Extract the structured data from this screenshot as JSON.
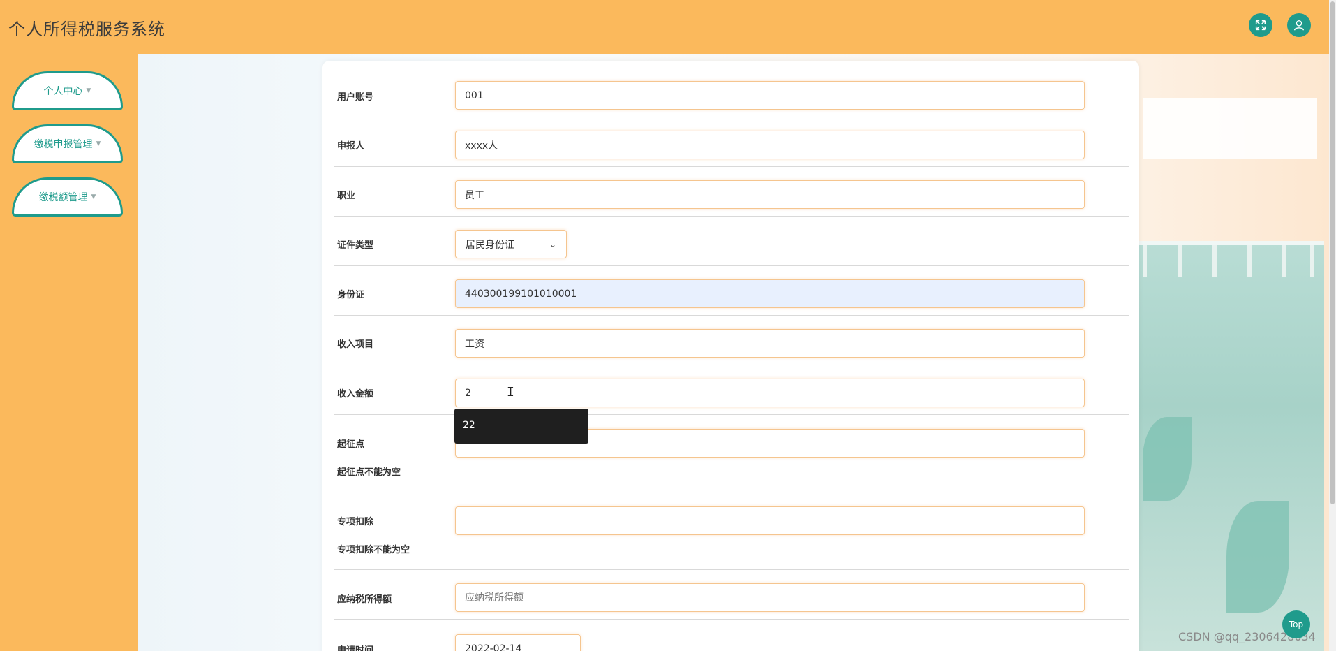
{
  "app_title": "个人所得税服务系统",
  "header_icons": {
    "fullscreen": "expand-icon",
    "user": "user-icon"
  },
  "sidebar": {
    "items": [
      {
        "label": "个人中心"
      },
      {
        "label": "缴税申报管理"
      },
      {
        "label": "缴税额管理"
      }
    ]
  },
  "form": {
    "account": {
      "label": "用户账号",
      "value": "001"
    },
    "applicant": {
      "label": "申报人",
      "value": "xxxx人"
    },
    "occupation": {
      "label": "职业",
      "value": "员工"
    },
    "id_type": {
      "label": "证件类型",
      "value": "居民身份证"
    },
    "id_number": {
      "label": "身份证",
      "value": "440300199101010001"
    },
    "income_item": {
      "label": "收入项目",
      "value": "工资"
    },
    "income_amount": {
      "label": "收入金额",
      "value": "2"
    },
    "threshold": {
      "label": "起征点",
      "value": "",
      "error": "起征点不能为空"
    },
    "deduction": {
      "label": "专项扣除",
      "value": "",
      "error": "专项扣除不能为空"
    },
    "taxable": {
      "label": "应纳税所得额",
      "placeholder": "应纳税所得额"
    },
    "apply_time": {
      "label": "申请时间",
      "value": "2022-02-14"
    }
  },
  "autocomplete": {
    "suggestion": "22"
  },
  "top_button": "Top",
  "watermark": "CSDN @qq_2306428634",
  "colors": {
    "accent": "#1f9b8c",
    "header_bg": "#fbb95c",
    "input_border": "#f5c58f"
  }
}
